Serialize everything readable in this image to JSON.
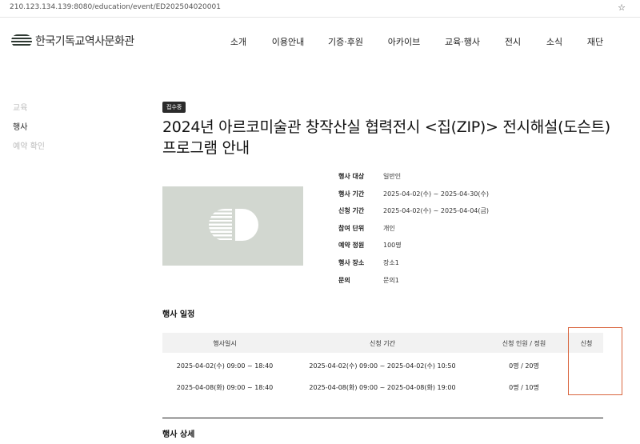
{
  "browser": {
    "url": "210.123.134.139:8080/education/event/ED202504020001"
  },
  "header": {
    "logo_text": "한국기독교역사문화관",
    "nav": [
      "소개",
      "이용안내",
      "기증·후원",
      "아카이브",
      "교육·행사",
      "전시",
      "소식",
      "재단"
    ]
  },
  "sidebar": {
    "items": [
      "교육",
      "행사",
      "예약 확인"
    ],
    "active": "행사"
  },
  "event": {
    "badge": "접수중",
    "title": "2024년 아르코미술관 창작산실 협력전시 <집(ZIP)> 전시해설(도슨트) 프로그램 안내",
    "info": [
      {
        "label": "행사 대상",
        "value": "일반인"
      },
      {
        "label": "행사 기간",
        "value": "2025-04-02(수) ~ 2025-04-30(수)"
      },
      {
        "label": "신청 기간",
        "value": "2025-04-02(수) ~ 2025-04-04(금)"
      },
      {
        "label": "참여 단위",
        "value": "개인"
      },
      {
        "label": "예약 정원",
        "value": "100명"
      },
      {
        "label": "행사 장소",
        "value": "장소1"
      },
      {
        "label": "문의",
        "value": "문의1"
      }
    ]
  },
  "schedule": {
    "title": "행사 일정",
    "columns": [
      "행사일시",
      "신청 기간",
      "신청 인원 / 정원",
      "신청"
    ],
    "rows": [
      {
        "datetime": "2025-04-02(수) 09:00 ~ 18:40",
        "period": "2025-04-02(수) 09:00 ~ 2025-04-02(수) 10:50",
        "count": "0명 / 20명",
        "apply": ""
      },
      {
        "datetime": "2025-04-08(화) 09:00 ~ 18:40",
        "period": "2025-04-08(화) 09:00 ~ 2025-04-08(화) 19:00",
        "count": "0명 / 10명",
        "apply": ""
      }
    ]
  },
  "detail": {
    "title": "행사 상세"
  }
}
